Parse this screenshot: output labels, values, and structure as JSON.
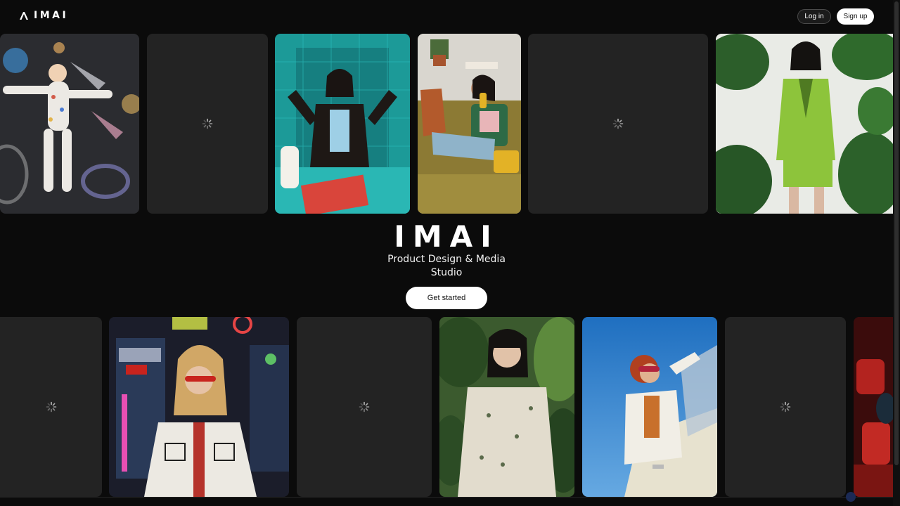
{
  "app": {
    "logo_text": "IMAI",
    "logo_icon": "imai-logo-icon"
  },
  "header": {
    "login_label": "Log in",
    "signup_label": "Sign up"
  },
  "hero": {
    "title": "IMAI",
    "subtitle": "Product Design & Media Studio",
    "cta_label": "Get started"
  },
  "gallery": {
    "top_row": [
      {
        "state": "image",
        "subject": "child in space pajamas on chalk-drawn galaxy"
      },
      {
        "state": "loading"
      },
      {
        "state": "image",
        "subject": "woman in teal tiled room with milkshake"
      },
      {
        "state": "image",
        "subject": "woman on olive sofa with yellow phone"
      },
      {
        "state": "loading"
      },
      {
        "state": "image",
        "subject": "woman in lime suit with monstera leaves"
      }
    ],
    "bottom_row": [
      {
        "state": "loading"
      },
      {
        "state": "image",
        "subject": "woman in arcade with red sunglasses"
      },
      {
        "state": "loading"
      },
      {
        "state": "image",
        "subject": "woman in embroidered sweater among leaves"
      },
      {
        "state": "image",
        "subject": "woman leaning out of vintage car"
      },
      {
        "state": "loading"
      },
      {
        "state": "image",
        "subject": "red cinema seats"
      }
    ]
  },
  "colors": {
    "background": "#0b0b0b",
    "placeholder": "#232323",
    "button_light": "#ffffff"
  }
}
